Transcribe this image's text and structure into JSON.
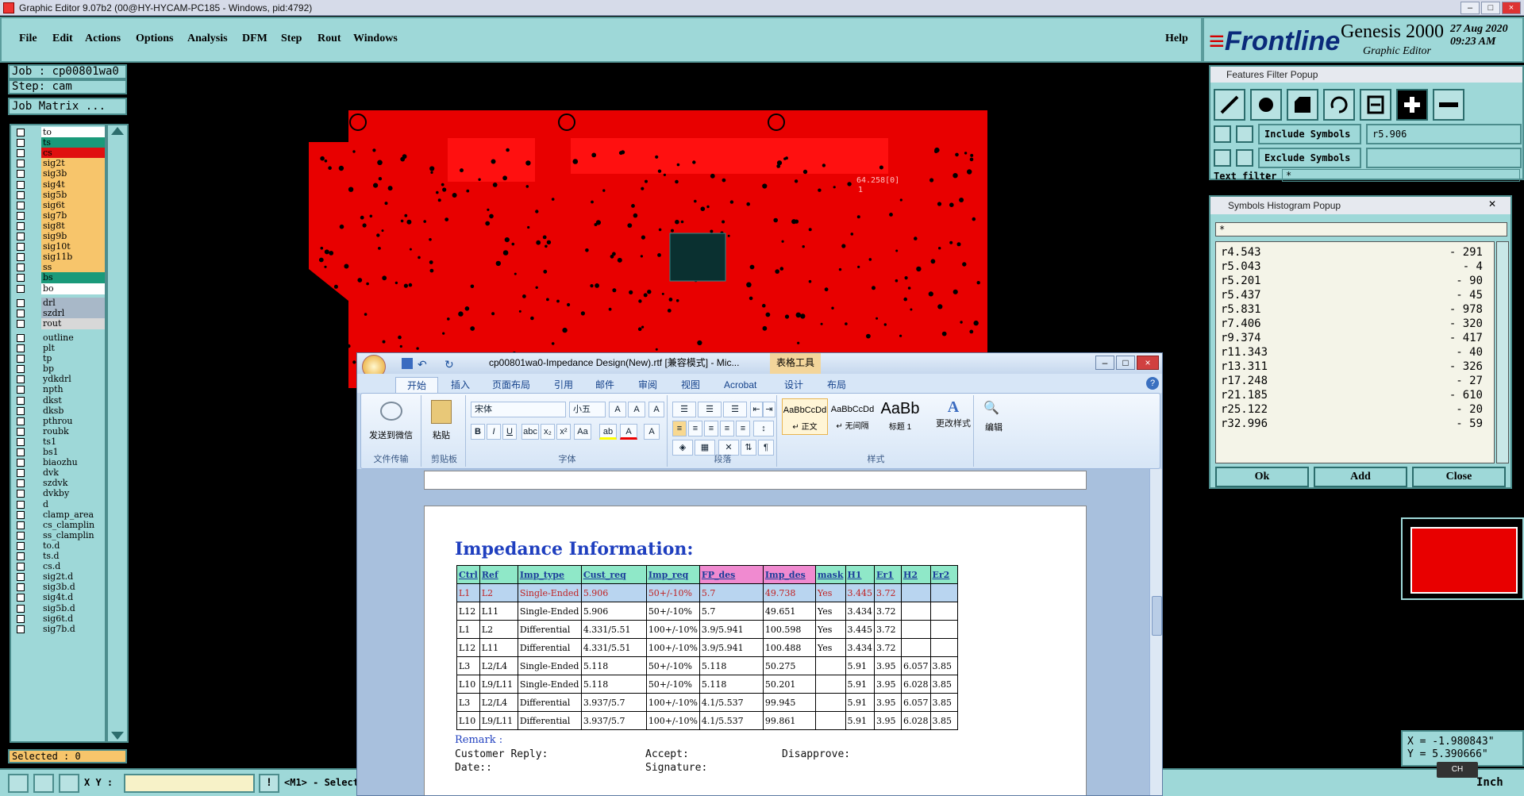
{
  "window": {
    "title": "Graphic Editor 9.07b2 (00@HY-HYCAM-PC185 - Windows, pid:4792)"
  },
  "menu": {
    "items": [
      "File",
      "Edit",
      "Actions",
      "Options",
      "Analysis",
      "DFM",
      "Step",
      "Rout",
      "Windows"
    ],
    "help": "Help"
  },
  "brand": {
    "logo": "Frontline",
    "product": "Genesis 2000",
    "subtitle": "Graphic Editor",
    "date": "27 Aug 2020",
    "time": "09:23 AM"
  },
  "job": {
    "job_label": "Job : cp00801wa0",
    "step_label": "Step: cam",
    "matrix_button": "Job Matrix ..."
  },
  "layers": [
    {
      "name": "to",
      "color": "#ffffff"
    },
    {
      "name": "ts",
      "color": "#1a9a7a"
    },
    {
      "name": "cs",
      "color": "#e01010"
    },
    {
      "name": "sig2t",
      "color": "#f7c56b"
    },
    {
      "name": "sig3b",
      "color": "#f7c56b"
    },
    {
      "name": "sig4t",
      "color": "#f7c56b"
    },
    {
      "name": "sig5b",
      "color": "#f7c56b"
    },
    {
      "name": "sig6t",
      "color": "#f7c56b"
    },
    {
      "name": "sig7b",
      "color": "#f7c56b"
    },
    {
      "name": "sig8t",
      "color": "#f7c56b"
    },
    {
      "name": "sig9b",
      "color": "#f7c56b"
    },
    {
      "name": "sig10t",
      "color": "#f7c56b"
    },
    {
      "name": "sig11b",
      "color": "#f7c56b"
    },
    {
      "name": "ss",
      "color": "#f7c56b"
    },
    {
      "name": "bs",
      "color": "#1a9a7a"
    },
    {
      "name": "bo",
      "color": "#ffffff"
    },
    {
      "name": "drl",
      "color": "#a8b8c8"
    },
    {
      "name": "szdrl",
      "color": "#a8b8c8"
    },
    {
      "name": "rout",
      "color": "#d8d8d8"
    },
    {
      "name": "outline",
      "color": "#9ed8d8"
    },
    {
      "name": "plt",
      "color": "#9ed8d8"
    },
    {
      "name": "tp",
      "color": "#9ed8d8"
    },
    {
      "name": "bp",
      "color": "#9ed8d8"
    },
    {
      "name": "ydkdrl",
      "color": "#9ed8d8"
    },
    {
      "name": "npth",
      "color": "#9ed8d8"
    },
    {
      "name": "dkst",
      "color": "#9ed8d8"
    },
    {
      "name": "dksb",
      "color": "#9ed8d8"
    },
    {
      "name": "pthrou",
      "color": "#9ed8d8"
    },
    {
      "name": "roubk",
      "color": "#9ed8d8"
    },
    {
      "name": "ts1",
      "color": "#9ed8d8"
    },
    {
      "name": "bs1",
      "color": "#9ed8d8"
    },
    {
      "name": "biaozhu",
      "color": "#9ed8d8"
    },
    {
      "name": "dvk",
      "color": "#9ed8d8"
    },
    {
      "name": "szdvk",
      "color": "#9ed8d8"
    },
    {
      "name": "dvkby",
      "color": "#9ed8d8"
    },
    {
      "name": "d",
      "color": "#9ed8d8"
    },
    {
      "name": "clamp_area",
      "color": "#9ed8d8"
    },
    {
      "name": "cs_clamplin",
      "color": "#9ed8d8"
    },
    {
      "name": "ss_clamplin",
      "color": "#9ed8d8"
    },
    {
      "name": "to.d",
      "color": "#9ed8d8"
    },
    {
      "name": "ts.d",
      "color": "#9ed8d8"
    },
    {
      "name": "cs.d",
      "color": "#9ed8d8"
    },
    {
      "name": "sig2t.d",
      "color": "#9ed8d8"
    },
    {
      "name": "sig3b.d",
      "color": "#9ed8d8"
    },
    {
      "name": "sig4t.d",
      "color": "#9ed8d8"
    },
    {
      "name": "sig5b.d",
      "color": "#9ed8d8"
    },
    {
      "name": "sig6t.d",
      "color": "#9ed8d8"
    },
    {
      "name": "sig7b.d",
      "color": "#9ed8d8"
    }
  ],
  "selected_label": "Selected : 0",
  "bottom": {
    "xy_label": "X Y :",
    "xy_value": "",
    "message": "<M1> - Select",
    "units": "Inch"
  },
  "canvas": {
    "annotation": "64.258[0]",
    "annotation2": "1"
  },
  "features_popup": {
    "title": "Features Filter Popup",
    "include_label": "Include Symbols :",
    "include_value": "r5.906",
    "exclude_label": "Exclude Symbols :",
    "exclude_value": "",
    "text_filter_label": "Text filter",
    "text_filter_value": "*"
  },
  "histogram_popup": {
    "title": "Symbols Histogram Popup",
    "filter": "*",
    "rows": [
      {
        "sym": "r4.543",
        "count": "- 291"
      },
      {
        "sym": "r5.043",
        "count": "- 4"
      },
      {
        "sym": "r5.201",
        "count": "- 90"
      },
      {
        "sym": "r5.437",
        "count": "- 45"
      },
      {
        "sym": "r5.831",
        "count": "- 978"
      },
      {
        "sym": "r7.406",
        "count": "- 320"
      },
      {
        "sym": "r9.374",
        "count": "- 417"
      },
      {
        "sym": "r11.343",
        "count": "- 40"
      },
      {
        "sym": "r13.311",
        "count": "- 326"
      },
      {
        "sym": "r17.248",
        "count": "- 27"
      },
      {
        "sym": "r21.185",
        "count": "- 610"
      },
      {
        "sym": "r25.122",
        "count": "- 20"
      },
      {
        "sym": "r32.996",
        "count": "- 59"
      }
    ],
    "ok": "Ok",
    "add": "Add",
    "close": "Close"
  },
  "coords": {
    "x": "X = -1.980843\"",
    "y": "Y = 5.390666\""
  },
  "ime": "CH",
  "word": {
    "title": "cp00801wa0-Impedance Design(New).rtf [兼容模式] - Mic...",
    "context_tab": "表格工具",
    "tabs": [
      "开始",
      "插入",
      "页面布局",
      "引用",
      "邮件",
      "审阅",
      "视图",
      "Acrobat",
      "设计",
      "布局"
    ],
    "groups": {
      "wechat": "发送到微信",
      "file_transfer": "文件传输",
      "paste": "粘贴",
      "clipboard": "剪贴板",
      "font_name": "宋体",
      "font_size": "小五",
      "font": "字体",
      "paragraph": "段落",
      "style1_preview": "AaBbCcDd",
      "style1": "↵ 正文",
      "style2_preview": "AaBbCcDd",
      "style2": "↵ 无间隔",
      "style3_preview": "AaBb",
      "style3": "标题 1",
      "change_styles": "更改样式",
      "styles": "样式",
      "edit": "编辑"
    },
    "doc": {
      "heading": "Impedance Information:",
      "headers": [
        "Ctrl",
        "Ref",
        "Imp_type",
        "Cust_req",
        "Imp_req",
        "FP_des",
        "Imp_des",
        "mask",
        "H1",
        "Er1",
        "H2",
        "Er2"
      ],
      "header_colors": [
        "#8fe8c8",
        "#8fe8c8",
        "#8fe8c8",
        "#8fe8c8",
        "#8fe8c8",
        "#f08ad0",
        "#f08ad0",
        "#8fe8c8",
        "#8fe8c8",
        "#8fe8c8",
        "#8fe8c8",
        "#8fe8c8"
      ],
      "rows": [
        [
          "L1",
          "L2",
          "Single-Ended",
          "5.906",
          "50+/-10%",
          "5.7",
          "49.738",
          "Yes",
          "3.445",
          "3.72",
          "",
          ""
        ],
        [
          "L12",
          "L11",
          "Single-Ended",
          "5.906",
          "50+/-10%",
          "5.7",
          "49.651",
          "Yes",
          "3.434",
          "3.72",
          "",
          ""
        ],
        [
          "L1",
          "L2",
          "Differential",
          "4.331/5.51",
          "100+/-10%",
          "3.9/5.941",
          "100.598",
          "Yes",
          "3.445",
          "3.72",
          "",
          ""
        ],
        [
          "L12",
          "L11",
          "Differential",
          "4.331/5.51",
          "100+/-10%",
          "3.9/5.941",
          "100.488",
          "Yes",
          "3.434",
          "3.72",
          "",
          ""
        ],
        [
          "L3",
          "L2/L4",
          "Single-Ended",
          "5.118",
          "50+/-10%",
          "5.118",
          "50.275",
          "",
          "5.91",
          "3.95",
          "6.057",
          "3.85"
        ],
        [
          "L10",
          "L9/L11",
          "Single-Ended",
          "5.118",
          "50+/-10%",
          "5.118",
          "50.201",
          "",
          "5.91",
          "3.95",
          "6.028",
          "3.85"
        ],
        [
          "L3",
          "L2/L4",
          "Differential",
          "3.937/5.7",
          "100+/-10%",
          "4.1/5.537",
          "99.945",
          "",
          "5.91",
          "3.95",
          "6.057",
          "3.85"
        ],
        [
          "L10",
          "L9/L11",
          "Differential",
          "3.937/5.7",
          "100+/-10%",
          "4.1/5.537",
          "99.861",
          "",
          "5.91",
          "3.95",
          "6.028",
          "3.85"
        ]
      ],
      "remark": "Remark :",
      "customer_reply": "Customer Reply:",
      "accept": "Accept:",
      "disapprove": "Disapprove:",
      "date": "Date::",
      "signature": "Signature:"
    }
  }
}
